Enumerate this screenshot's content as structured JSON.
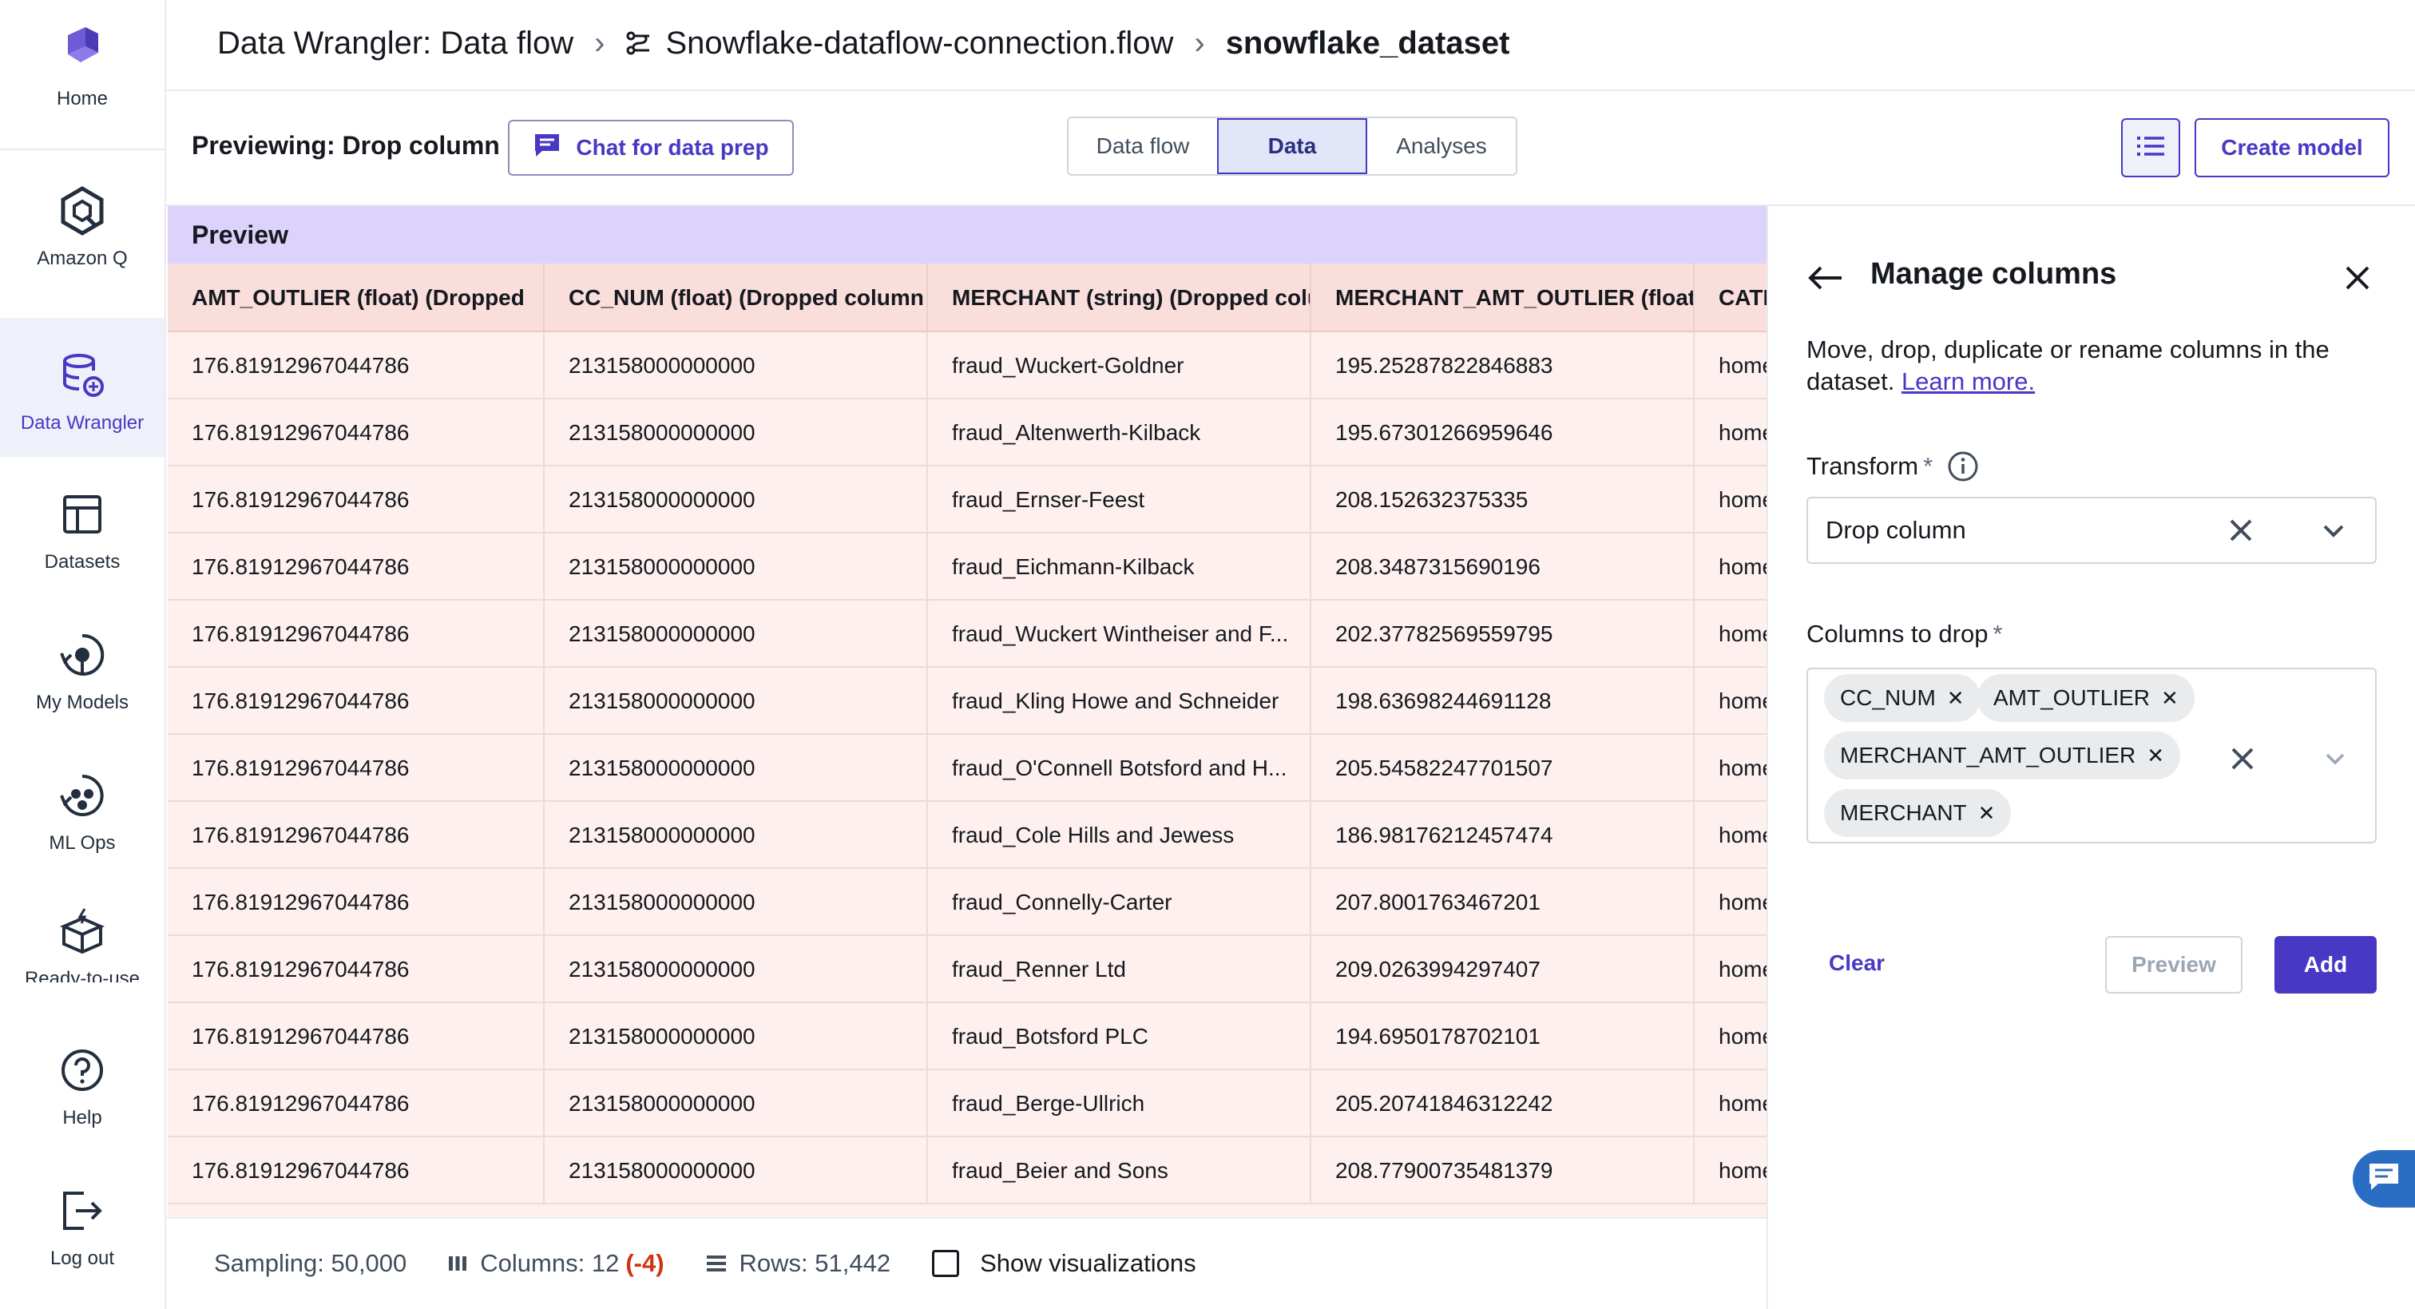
{
  "nav": {
    "items": [
      {
        "label": "Home",
        "icon": "home-logo-icon"
      },
      {
        "label": "Amazon Q",
        "icon": "amazon-q-icon"
      },
      {
        "label": "Data Wrangler",
        "icon": "data-wrangler-icon"
      },
      {
        "label": "Datasets",
        "icon": "datasets-icon"
      },
      {
        "label": "My Models",
        "icon": "my-models-icon"
      },
      {
        "label": "ML Ops",
        "icon": "ml-ops-icon"
      },
      {
        "label": "Ready-to-use",
        "icon": "ready-to-use-icon"
      },
      {
        "label": "Help",
        "icon": "help-icon"
      },
      {
        "label": "Log out",
        "icon": "log-out-icon"
      }
    ]
  },
  "breadcrumb": {
    "root": "Data Wrangler: Data flow",
    "flow": "Snowflake-dataflow-connection.flow",
    "dataset": "snowflake_dataset"
  },
  "toolbar": {
    "previewing": "Previewing: Drop column",
    "chat_label": "Chat for data prep",
    "tabs": [
      "Data flow",
      "Data",
      "Analyses"
    ],
    "active_tab": "Data",
    "create_model": "Create model"
  },
  "table": {
    "title": "Preview",
    "columns": [
      "AMT_OUTLIER (float) (Dropped",
      "CC_NUM (float) (Dropped column",
      "MERCHANT (string) (Dropped colu",
      "MERCHANT_AMT_OUTLIER (float)",
      "CATE"
    ],
    "rows": [
      [
        "176.81912967044786",
        "213158000000000",
        "fraud_Wuckert-Goldner",
        "195.25287822846883",
        "home"
      ],
      [
        "176.81912967044786",
        "213158000000000",
        "fraud_Altenwerth-Kilback",
        "195.67301266959646",
        "home"
      ],
      [
        "176.81912967044786",
        "213158000000000",
        "fraud_Ernser-Feest",
        "208.152632375335",
        "home"
      ],
      [
        "176.81912967044786",
        "213158000000000",
        "fraud_Eichmann-Kilback",
        "208.3487315690196",
        "home"
      ],
      [
        "176.81912967044786",
        "213158000000000",
        "fraud_Wuckert Wintheiser and F...",
        "202.37782569559795",
        "home"
      ],
      [
        "176.81912967044786",
        "213158000000000",
        "fraud_Kling Howe and Schneider",
        "198.63698244691128",
        "home"
      ],
      [
        "176.81912967044786",
        "213158000000000",
        "fraud_O'Connell Botsford and H...",
        "205.54582247701507",
        "home"
      ],
      [
        "176.81912967044786",
        "213158000000000",
        "fraud_Cole Hills and Jewess",
        "186.98176212457474",
        "home"
      ],
      [
        "176.81912967044786",
        "213158000000000",
        "fraud_Connelly-Carter",
        "207.8001763467201",
        "home"
      ],
      [
        "176.81912967044786",
        "213158000000000",
        "fraud_Renner Ltd",
        "209.0263994297407",
        "home"
      ],
      [
        "176.81912967044786",
        "213158000000000",
        "fraud_Botsford PLC",
        "194.6950178702101",
        "home"
      ],
      [
        "176.81912967044786",
        "213158000000000",
        "fraud_Berge-Ullrich",
        "205.20741846312242",
        "home"
      ],
      [
        "176.81912967044786",
        "213158000000000",
        "fraud_Beier and Sons",
        "208.77900735481379",
        "home"
      ]
    ]
  },
  "footer": {
    "sampling": "Sampling: 50,000",
    "columns": "Columns: 12",
    "columns_delta": "(-4)",
    "rows": "Rows: 51,442",
    "show_vis": "Show visualizations"
  },
  "panel": {
    "title": "Manage columns",
    "description": "Move, drop, duplicate or rename columns in the dataset.",
    "learn_more": "Learn more.",
    "transform_label": "Transform",
    "required_mark": "*",
    "transform_value": "Drop column",
    "columns_label": "Columns to drop",
    "tokens": [
      "CC_NUM",
      "AMT_OUTLIER",
      "MERCHANT_AMT_OUTLIER",
      "MERCHANT"
    ],
    "clear": "Clear",
    "preview": "Preview",
    "add": "Add"
  },
  "colors": {
    "accent": "#4838c4",
    "preview_header": "#ddd2fb",
    "dropped_column": "#f9dedc",
    "negative": "#d13212"
  }
}
